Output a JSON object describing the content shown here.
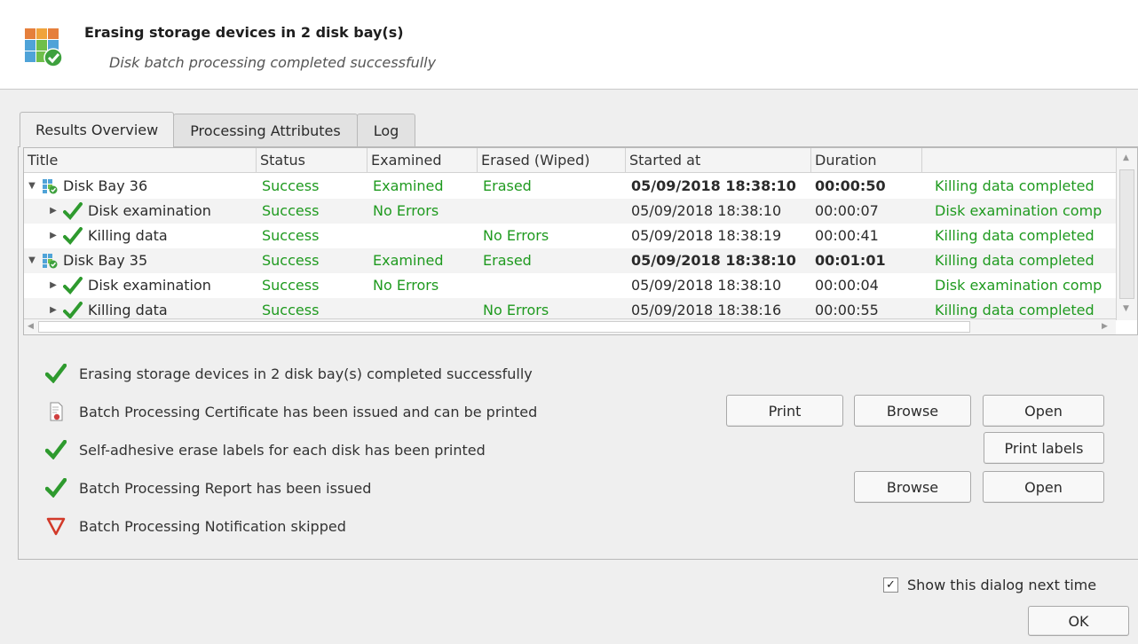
{
  "header": {
    "title": "Erasing storage devices in 2 disk bay(s)",
    "subtitle": "Disk batch processing completed successfully"
  },
  "tabs": [
    {
      "label": "Results Overview",
      "active": true
    },
    {
      "label": "Processing Attributes",
      "active": false
    },
    {
      "label": "Log",
      "active": false
    }
  ],
  "grid": {
    "columns": [
      "Title",
      "Status",
      "Examined",
      "Erased (Wiped)",
      "Started at",
      "Duration",
      ""
    ],
    "rows": [
      {
        "title": "Disk Bay 36",
        "level": 0,
        "icon": "disk-bay-icon",
        "status": "Success",
        "examined": "Examined",
        "erased": "Erased",
        "started": "05/09/2018 18:38:10",
        "duration": "00:00:50",
        "message": "Killing data completed",
        "bold": true
      },
      {
        "title": "Disk examination",
        "level": 1,
        "icon": "check-icon",
        "status": "Success",
        "examined": "No Errors",
        "erased": "",
        "started": "05/09/2018 18:38:10",
        "duration": "00:00:07",
        "message": "Disk examination comp",
        "bold": false
      },
      {
        "title": "Killing data",
        "level": 1,
        "icon": "check-icon",
        "status": "Success",
        "examined": "",
        "erased": "No Errors",
        "started": "05/09/2018 18:38:19",
        "duration": "00:00:41",
        "message": "Killing data completed",
        "bold": false
      },
      {
        "title": "Disk Bay 35",
        "level": 0,
        "icon": "disk-bay-icon",
        "status": "Success",
        "examined": "Examined",
        "erased": "Erased",
        "started": "05/09/2018 18:38:10",
        "duration": "00:01:01",
        "message": "Killing data completed",
        "bold": true
      },
      {
        "title": "Disk examination",
        "level": 1,
        "icon": "check-icon",
        "status": "Success",
        "examined": "No Errors",
        "erased": "",
        "started": "05/09/2018 18:38:10",
        "duration": "00:00:04",
        "message": "Disk examination comp",
        "bold": false
      },
      {
        "title": "Killing data",
        "level": 1,
        "icon": "check-icon",
        "status": "Success",
        "examined": "",
        "erased": "No Errors",
        "started": "05/09/2018 18:38:16",
        "duration": "00:00:55",
        "message": "Killing data completed",
        "bold": false
      }
    ]
  },
  "summary": {
    "erase_done": "Erasing storage devices in 2 disk bay(s) completed successfully",
    "certificate": "Batch Processing Certificate has been issued and can be printed",
    "labels": "Self-adhesive erase labels for each disk has been printed",
    "report": "Batch Processing Report has been issued",
    "notification": "Batch Processing Notification skipped"
  },
  "buttons": {
    "print": "Print",
    "browse": "Browse",
    "open": "Open",
    "print_labels": "Print labels",
    "ok": "OK"
  },
  "footer": {
    "show_dialog_label": "Show this dialog next time",
    "show_dialog_checked": true,
    "check_mark": "✓"
  },
  "colors": {
    "success": "#1f9a1f",
    "warning": "#d23a2a"
  }
}
